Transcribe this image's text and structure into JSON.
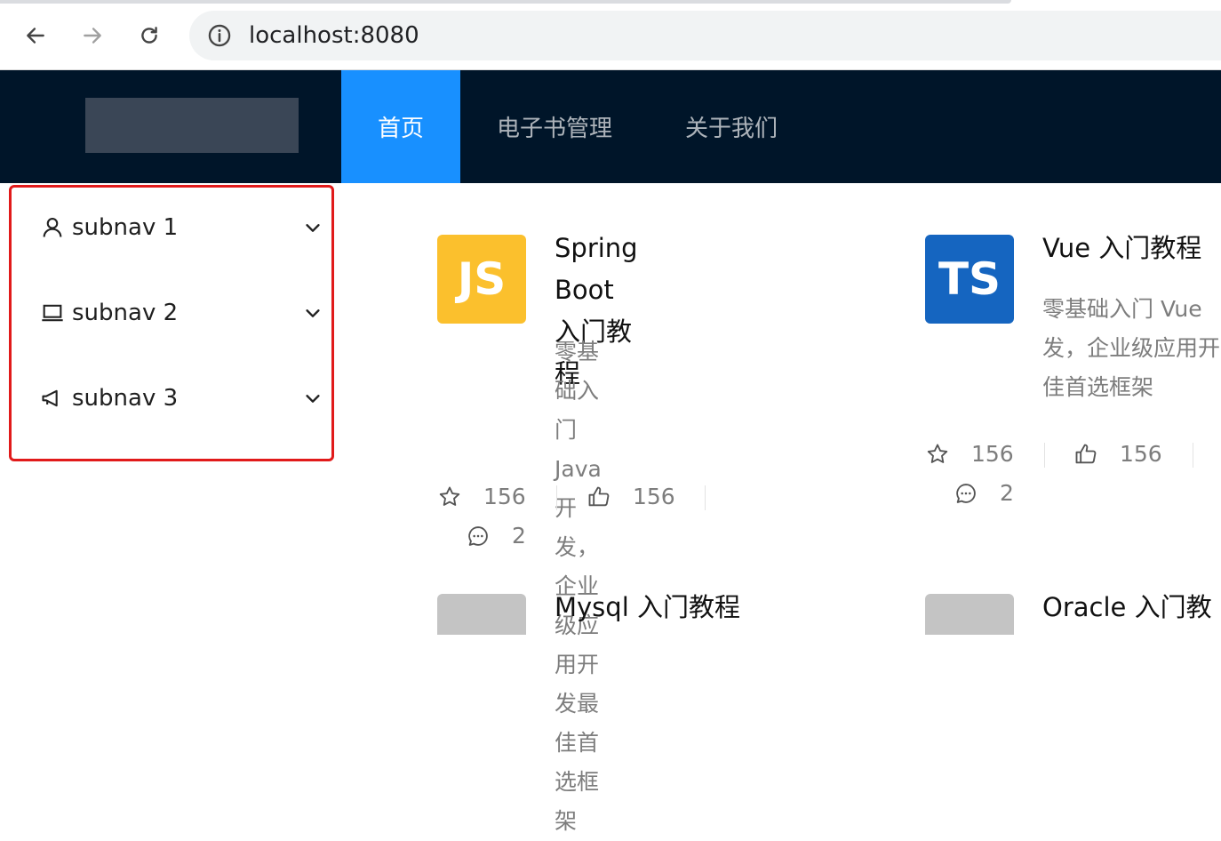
{
  "browser": {
    "url": "localhost:8080"
  },
  "header": {
    "menu": [
      {
        "label": "首页",
        "active": true
      },
      {
        "label": "电子书管理",
        "active": false
      },
      {
        "label": "关于我们",
        "active": false
      }
    ]
  },
  "sidebar": {
    "items": [
      {
        "label": "subnav 1",
        "icon": "user-icon"
      },
      {
        "label": "subnav 2",
        "icon": "laptop-icon"
      },
      {
        "label": "subnav 3",
        "icon": "notification-icon"
      }
    ]
  },
  "cards": [
    {
      "avatar_text": "JS",
      "avatar_bg": "#fbc02d",
      "avatar_color": "#ffffff",
      "title_line1": "Spring Boot 入门教",
      "title_line2": "程",
      "desc": [
        "零基础入门 Java 开",
        "发，企业级应用开发最",
        "佳首选框架"
      ],
      "stars": "156",
      "likes": "156",
      "comments": "2"
    },
    {
      "avatar_text": "TS",
      "avatar_bg": "#1565c0",
      "avatar_color": "#ffffff",
      "title_line1": "Vue 入门教程",
      "desc": [
        "零基础入门 Vue",
        "发，企业级应用开",
        "佳首选框架"
      ],
      "stars": "156",
      "likes": "156",
      "comments": "2"
    },
    {
      "avatar_bg": "#c4c4c4",
      "title_line1": "Mysql 入门教程"
    },
    {
      "avatar_bg": "#c4c4c4",
      "title_line1": "Oracle 入门教"
    }
  ],
  "colors": {
    "header_bg": "#001529",
    "active_menu": "#1890ff",
    "sidebar_border": "#e11a1a"
  }
}
